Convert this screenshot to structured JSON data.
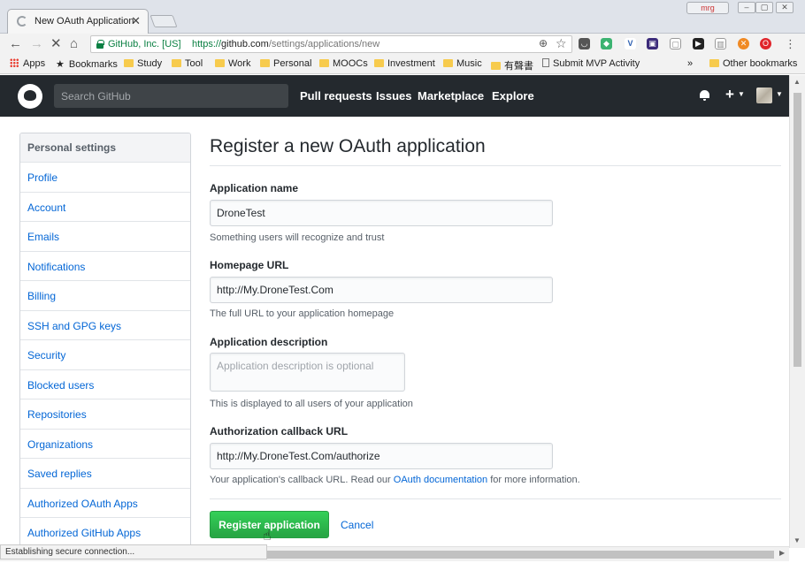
{
  "browser": {
    "tab_title": "New OAuth Application",
    "tab_close": "✕",
    "window_user": "mrg",
    "window_buttons": [
      "–",
      "▢",
      "✕"
    ],
    "secure_label": "GitHub, Inc. [US]",
    "url_scheme": "https://",
    "url_host": "github.com",
    "url_path": "/settings/applications/new",
    "bookmarks": [
      "Apps",
      "Bookmarks",
      "Study",
      "Tool",
      "Work",
      "Personal",
      "MOOCs",
      "Investment",
      "Music",
      "有聲書",
      "Submit MVP Activity"
    ],
    "bookmarks_more": "»",
    "other_bookmarks": "Other bookmarks",
    "status": "Establishing secure connection..."
  },
  "github": {
    "search_placeholder": "Search GitHub",
    "nav": [
      "Pull requests",
      "Issues",
      "Marketplace",
      "Explore"
    ]
  },
  "sidebar": {
    "heading": "Personal settings",
    "items": [
      "Profile",
      "Account",
      "Emails",
      "Notifications",
      "Billing",
      "SSH and GPG keys",
      "Security",
      "Blocked users",
      "Repositories",
      "Organizations",
      "Saved replies",
      "Authorized OAuth Apps",
      "Authorized GitHub Apps"
    ]
  },
  "form": {
    "title": "Register a new OAuth application",
    "app_name_label": "Application name",
    "app_name_value": "DroneTest",
    "app_name_note": "Something users will recognize and trust",
    "homepage_label": "Homepage URL",
    "homepage_value": "http://My.DroneTest.Com",
    "homepage_note": "The full URL to your application homepage",
    "description_label": "Application description",
    "description_placeholder": "Application description is optional",
    "description_note": "This is displayed to all users of your application",
    "callback_label": "Authorization callback URL",
    "callback_value": "http://My.DroneTest.Com/authorize",
    "callback_note_before": "Your application's callback URL. Read our ",
    "callback_note_link": "OAuth documentation",
    "callback_note_after": " for more information.",
    "submit_label": "Register application",
    "cancel_label": "Cancel"
  },
  "colors": {
    "header_bg": "#24292e",
    "link": "#0366d6",
    "primary_button": "#28a745",
    "secure_green": "#0b8043"
  }
}
